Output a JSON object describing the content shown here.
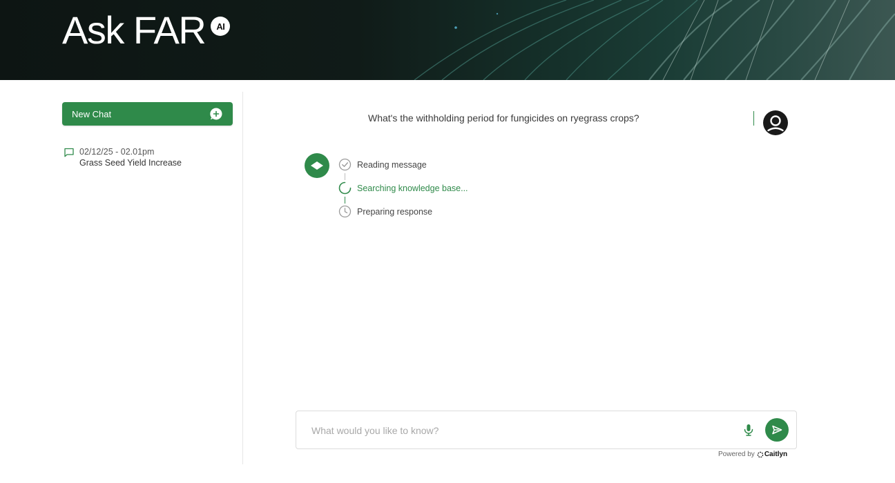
{
  "header": {
    "logo_text": "Ask FAR",
    "logo_badge": "AI"
  },
  "sidebar": {
    "new_chat_label": "New Chat",
    "history": [
      {
        "date": "02/12/25 - 02.01pm",
        "title": "Grass Seed Yield Increase"
      }
    ]
  },
  "conversation": {
    "user_message": "What's the withholding period for fungicides on ryegrass crops?",
    "steps": [
      {
        "label": "Reading message",
        "status": "done"
      },
      {
        "label": "Searching knowledge base...",
        "status": "in-progress"
      },
      {
        "label": "Preparing response",
        "status": "pending"
      }
    ]
  },
  "composer": {
    "placeholder": "What would you like to know?",
    "value": ""
  },
  "footer": {
    "powered_by": "Powered by",
    "brand": "Caitlyn"
  },
  "colors": {
    "accent": "#2f8a4a",
    "header_bg": "#0f1a17"
  },
  "icons": {
    "new_chat": "plus-circle-icon",
    "history": "chat-bubble-icon",
    "user": "user-avatar-icon",
    "bot": "diamond-logo-icon",
    "mic": "microphone-icon",
    "send": "send-icon",
    "step_done": "check-circle-icon",
    "step_active": "spinner-icon",
    "step_pending": "clock-icon"
  }
}
